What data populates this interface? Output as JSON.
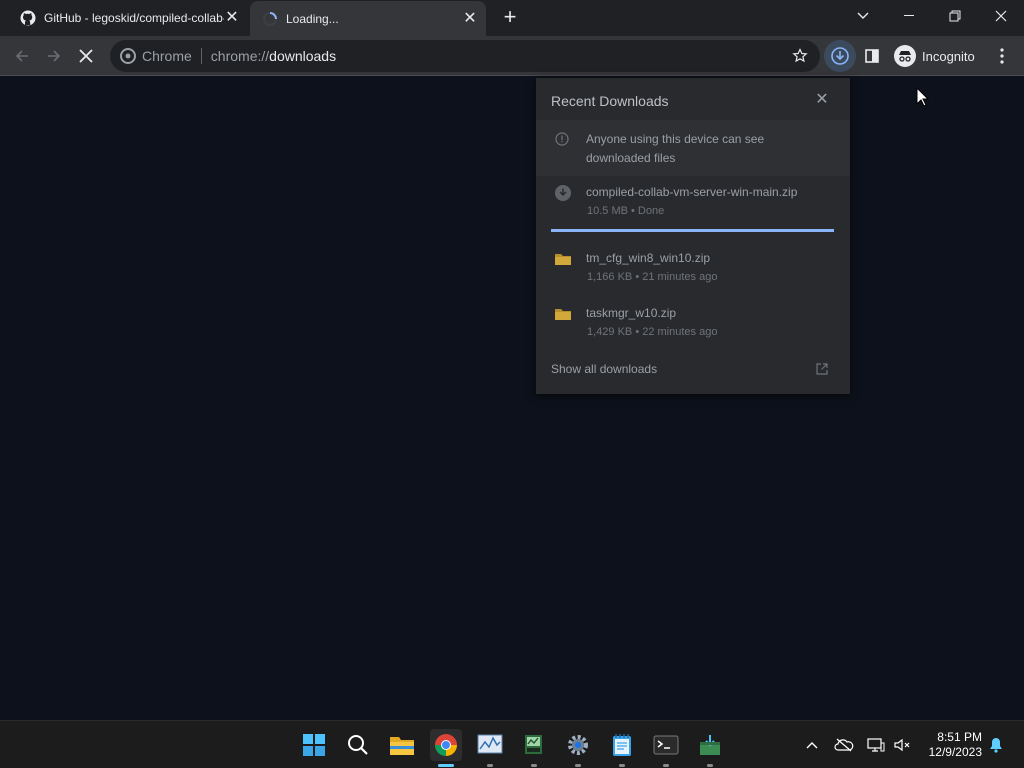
{
  "tabs": [
    {
      "title": "GitHub - legoskid/compiled-collab-vm-server",
      "favicon": "github-icon"
    },
    {
      "title": "Loading...",
      "favicon": "loading-spinner-icon"
    }
  ],
  "toolbar": {
    "omnibox_chip": "Chrome",
    "url_scheme": "chrome://",
    "url_host": "downloads",
    "profile_label": "Incognito"
  },
  "downloads": {
    "title": "Recent Downloads",
    "notice": "Anyone using this device can see downloaded files",
    "items": [
      {
        "name": "compiled-collab-vm-server-win-main.zip",
        "meta": "10.5 MB • Done",
        "icon": "pending-file-icon"
      },
      {
        "name": "tm_cfg_win8_win10.zip",
        "meta": "1,166 KB • 21 minutes ago",
        "icon": "folder-icon"
      },
      {
        "name": "taskmgr_w10.zip",
        "meta": "1,429 KB • 22 minutes ago",
        "icon": "folder-icon"
      }
    ],
    "show_all": "Show all downloads"
  },
  "taskbar": {
    "time": "8:51 PM",
    "date": "12/9/2023"
  },
  "colors": {
    "accent": "#8ab4f8",
    "page_bg": "#0d111b"
  }
}
